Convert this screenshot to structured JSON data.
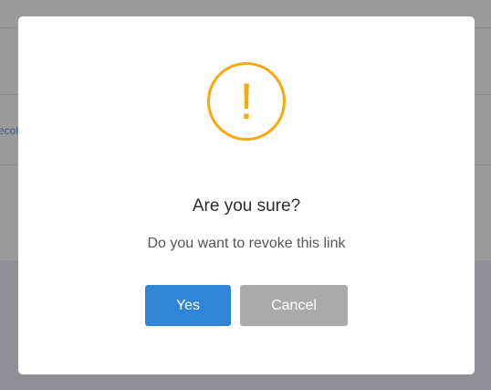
{
  "background": {
    "link_fragment": "ecol"
  },
  "dialog": {
    "icon": "warning-exclamation-icon",
    "icon_glyph": "!",
    "title": "Are you sure?",
    "text": "Do you want to revoke this link",
    "confirm_label": "Yes",
    "cancel_label": "Cancel"
  },
  "colors": {
    "warning": "#f5a90f",
    "confirm_button": "#3085d6",
    "cancel_button": "#aaaaaa",
    "overlay": "#9a9a9a"
  }
}
